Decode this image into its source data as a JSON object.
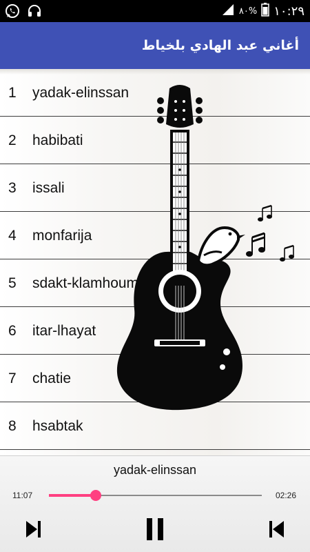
{
  "status_bar": {
    "time": "١٠:٢٩",
    "battery": "٨٠%",
    "left_icons": [
      "whatsapp-icon",
      "headset-icon"
    ],
    "right_icons": [
      "signal-icon",
      "battery-icon"
    ]
  },
  "app_bar": {
    "title": "أغاني عبد الهادي بلخياط",
    "color": "#3f51b5"
  },
  "songs": [
    {
      "number": "1",
      "title": "yadak-elinssan"
    },
    {
      "number": "2",
      "title": "habibati"
    },
    {
      "number": "3",
      "title": "issali"
    },
    {
      "number": "4",
      "title": "monfarija"
    },
    {
      "number": "5",
      "title": "sdakt-klamhoum"
    },
    {
      "number": "6",
      "title": "itar-lhayat"
    },
    {
      "number": "7",
      "title": "chatie"
    },
    {
      "number": "8",
      "title": "hsabtak"
    }
  ],
  "player": {
    "now_playing": "yadak-elinssan",
    "current_time": "11:07",
    "total_time": "02:26",
    "progress": 0.22,
    "accent": "#ff4081",
    "controls": [
      "next-icon",
      "pause-icon",
      "previous-icon"
    ]
  }
}
